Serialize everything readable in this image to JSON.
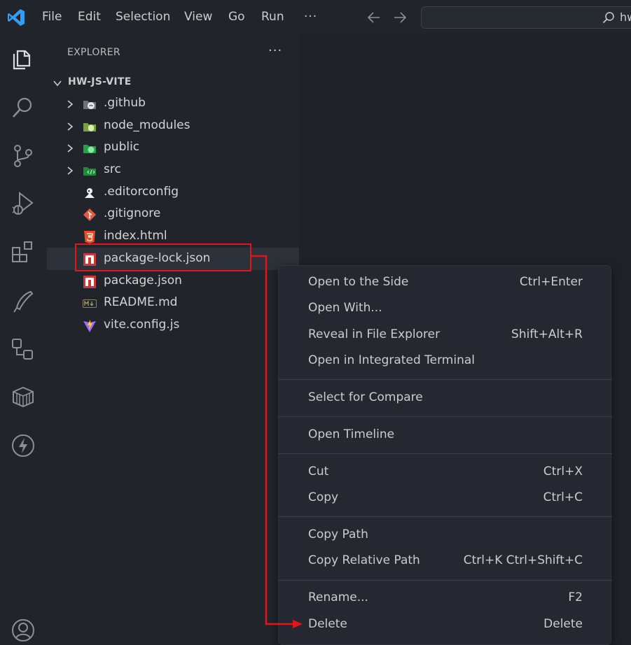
{
  "titlebar": {
    "menu": [
      "File",
      "Edit",
      "Selection",
      "View",
      "Go",
      "Run"
    ],
    "more": "···",
    "search_text": "hw"
  },
  "activity_bar": {
    "icons": [
      "explorer-icon",
      "search-icon",
      "source-control-icon",
      "run-debug-icon",
      "extensions-icon",
      "remote-explorer-icon",
      "remote-icon",
      "containers-icon",
      "thunder-icon",
      "account-icon"
    ]
  },
  "sidebar": {
    "header": "EXPLORER",
    "more": "···",
    "folder": "HW-JS-VITE",
    "items": [
      {
        "label": ".github",
        "type": "folder",
        "icon": "github-folder-icon"
      },
      {
        "label": "node_modules",
        "type": "folder",
        "icon": "node-folder-icon"
      },
      {
        "label": "public",
        "type": "folder",
        "icon": "public-folder-icon"
      },
      {
        "label": "src",
        "type": "folder",
        "icon": "src-folder-icon"
      },
      {
        "label": ".editorconfig",
        "type": "file",
        "icon": "editorconfig-icon"
      },
      {
        "label": ".gitignore",
        "type": "file",
        "icon": "git-icon"
      },
      {
        "label": "index.html",
        "type": "file",
        "icon": "html-icon"
      },
      {
        "label": "package-lock.json",
        "type": "file",
        "icon": "npm-icon",
        "selected": true
      },
      {
        "label": "package.json",
        "type": "file",
        "icon": "npm-icon"
      },
      {
        "label": "README.md",
        "type": "file",
        "icon": "markdown-icon"
      },
      {
        "label": "vite.config.js",
        "type": "file",
        "icon": "vite-icon"
      }
    ]
  },
  "context_menu": {
    "items": [
      {
        "label": "Open to the Side",
        "shortcut": "Ctrl+Enter"
      },
      {
        "label": "Open With...",
        "shortcut": ""
      },
      {
        "label": "Reveal in File Explorer",
        "shortcut": "Shift+Alt+R"
      },
      {
        "label": "Open in Integrated Terminal",
        "shortcut": ""
      },
      {
        "label": "Select for Compare",
        "shortcut": ""
      },
      {
        "label": "Open Timeline",
        "shortcut": ""
      },
      {
        "label": "Cut",
        "shortcut": "Ctrl+X"
      },
      {
        "label": "Copy",
        "shortcut": "Ctrl+C"
      },
      {
        "label": "Copy Path",
        "shortcut": ""
      },
      {
        "label": "Copy Relative Path",
        "shortcut": "Ctrl+K Ctrl+Shift+C"
      },
      {
        "label": "Rename...",
        "shortcut": "F2"
      },
      {
        "label": "Delete",
        "shortcut": "Delete"
      }
    ]
  },
  "colors": {
    "accent_blue": "#2f9ef3",
    "annotation_red": "#e5141b",
    "npm_red": "#cb3837",
    "html_orange": "#e44d26"
  }
}
